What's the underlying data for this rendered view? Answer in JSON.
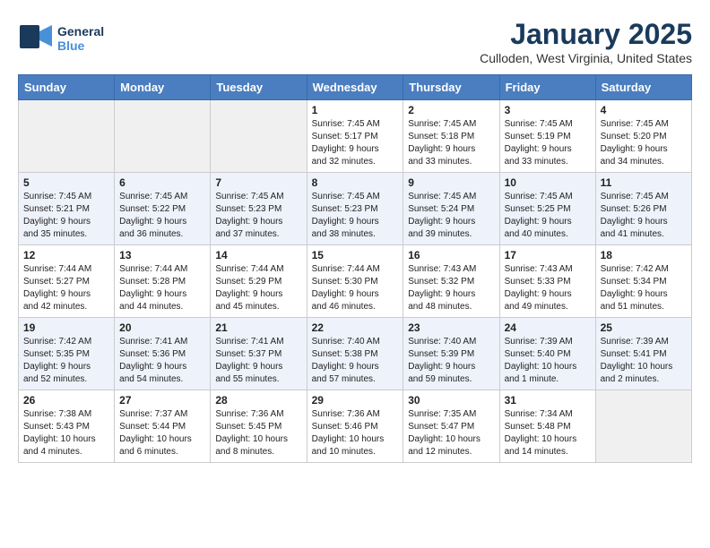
{
  "header": {
    "logo_general": "General",
    "logo_blue": "Blue",
    "month_year": "January 2025",
    "location": "Culloden, West Virginia, United States"
  },
  "weekdays": [
    "Sunday",
    "Monday",
    "Tuesday",
    "Wednesday",
    "Thursday",
    "Friday",
    "Saturday"
  ],
  "weeks": [
    [
      {
        "day": "",
        "info": ""
      },
      {
        "day": "",
        "info": ""
      },
      {
        "day": "",
        "info": ""
      },
      {
        "day": "1",
        "info": "Sunrise: 7:45 AM\nSunset: 5:17 PM\nDaylight: 9 hours\nand 32 minutes."
      },
      {
        "day": "2",
        "info": "Sunrise: 7:45 AM\nSunset: 5:18 PM\nDaylight: 9 hours\nand 33 minutes."
      },
      {
        "day": "3",
        "info": "Sunrise: 7:45 AM\nSunset: 5:19 PM\nDaylight: 9 hours\nand 33 minutes."
      },
      {
        "day": "4",
        "info": "Sunrise: 7:45 AM\nSunset: 5:20 PM\nDaylight: 9 hours\nand 34 minutes."
      }
    ],
    [
      {
        "day": "5",
        "info": "Sunrise: 7:45 AM\nSunset: 5:21 PM\nDaylight: 9 hours\nand 35 minutes."
      },
      {
        "day": "6",
        "info": "Sunrise: 7:45 AM\nSunset: 5:22 PM\nDaylight: 9 hours\nand 36 minutes."
      },
      {
        "day": "7",
        "info": "Sunrise: 7:45 AM\nSunset: 5:23 PM\nDaylight: 9 hours\nand 37 minutes."
      },
      {
        "day": "8",
        "info": "Sunrise: 7:45 AM\nSunset: 5:23 PM\nDaylight: 9 hours\nand 38 minutes."
      },
      {
        "day": "9",
        "info": "Sunrise: 7:45 AM\nSunset: 5:24 PM\nDaylight: 9 hours\nand 39 minutes."
      },
      {
        "day": "10",
        "info": "Sunrise: 7:45 AM\nSunset: 5:25 PM\nDaylight: 9 hours\nand 40 minutes."
      },
      {
        "day": "11",
        "info": "Sunrise: 7:45 AM\nSunset: 5:26 PM\nDaylight: 9 hours\nand 41 minutes."
      }
    ],
    [
      {
        "day": "12",
        "info": "Sunrise: 7:44 AM\nSunset: 5:27 PM\nDaylight: 9 hours\nand 42 minutes."
      },
      {
        "day": "13",
        "info": "Sunrise: 7:44 AM\nSunset: 5:28 PM\nDaylight: 9 hours\nand 44 minutes."
      },
      {
        "day": "14",
        "info": "Sunrise: 7:44 AM\nSunset: 5:29 PM\nDaylight: 9 hours\nand 45 minutes."
      },
      {
        "day": "15",
        "info": "Sunrise: 7:44 AM\nSunset: 5:30 PM\nDaylight: 9 hours\nand 46 minutes."
      },
      {
        "day": "16",
        "info": "Sunrise: 7:43 AM\nSunset: 5:32 PM\nDaylight: 9 hours\nand 48 minutes."
      },
      {
        "day": "17",
        "info": "Sunrise: 7:43 AM\nSunset: 5:33 PM\nDaylight: 9 hours\nand 49 minutes."
      },
      {
        "day": "18",
        "info": "Sunrise: 7:42 AM\nSunset: 5:34 PM\nDaylight: 9 hours\nand 51 minutes."
      }
    ],
    [
      {
        "day": "19",
        "info": "Sunrise: 7:42 AM\nSunset: 5:35 PM\nDaylight: 9 hours\nand 52 minutes."
      },
      {
        "day": "20",
        "info": "Sunrise: 7:41 AM\nSunset: 5:36 PM\nDaylight: 9 hours\nand 54 minutes."
      },
      {
        "day": "21",
        "info": "Sunrise: 7:41 AM\nSunset: 5:37 PM\nDaylight: 9 hours\nand 55 minutes."
      },
      {
        "day": "22",
        "info": "Sunrise: 7:40 AM\nSunset: 5:38 PM\nDaylight: 9 hours\nand 57 minutes."
      },
      {
        "day": "23",
        "info": "Sunrise: 7:40 AM\nSunset: 5:39 PM\nDaylight: 9 hours\nand 59 minutes."
      },
      {
        "day": "24",
        "info": "Sunrise: 7:39 AM\nSunset: 5:40 PM\nDaylight: 10 hours\nand 1 minute."
      },
      {
        "day": "25",
        "info": "Sunrise: 7:39 AM\nSunset: 5:41 PM\nDaylight: 10 hours\nand 2 minutes."
      }
    ],
    [
      {
        "day": "26",
        "info": "Sunrise: 7:38 AM\nSunset: 5:43 PM\nDaylight: 10 hours\nand 4 minutes."
      },
      {
        "day": "27",
        "info": "Sunrise: 7:37 AM\nSunset: 5:44 PM\nDaylight: 10 hours\nand 6 minutes."
      },
      {
        "day": "28",
        "info": "Sunrise: 7:36 AM\nSunset: 5:45 PM\nDaylight: 10 hours\nand 8 minutes."
      },
      {
        "day": "29",
        "info": "Sunrise: 7:36 AM\nSunset: 5:46 PM\nDaylight: 10 hours\nand 10 minutes."
      },
      {
        "day": "30",
        "info": "Sunrise: 7:35 AM\nSunset: 5:47 PM\nDaylight: 10 hours\nand 12 minutes."
      },
      {
        "day": "31",
        "info": "Sunrise: 7:34 AM\nSunset: 5:48 PM\nDaylight: 10 hours\nand 14 minutes."
      },
      {
        "day": "",
        "info": ""
      }
    ]
  ]
}
